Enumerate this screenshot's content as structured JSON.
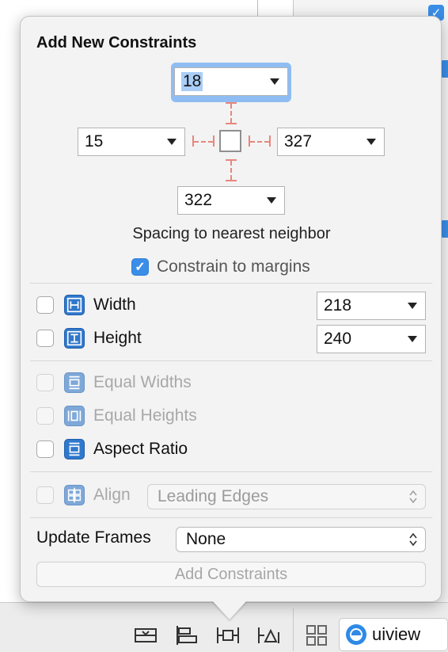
{
  "popover": {
    "title": "Add New Constraints",
    "spacing": {
      "top": "18",
      "left": "15",
      "right": "327",
      "bottom": "322",
      "caption": "Spacing to nearest neighbor"
    },
    "constrain_to_margins": {
      "label": "Constrain to margins",
      "checked": true
    },
    "size_rows": [
      {
        "label": "Width",
        "value": "218",
        "checked": false,
        "enabled": true
      },
      {
        "label": "Height",
        "value": "240",
        "checked": false,
        "enabled": true
      }
    ],
    "relation_rows": [
      {
        "label": "Equal Widths",
        "checked": false,
        "enabled": false
      },
      {
        "label": "Equal Heights",
        "checked": false,
        "enabled": false
      },
      {
        "label": "Aspect Ratio",
        "checked": false,
        "enabled": true
      }
    ],
    "align": {
      "label": "Align",
      "value": "Leading Edges",
      "enabled": false
    },
    "update_frames": {
      "label": "Update Frames",
      "value": "None"
    },
    "add_button": "Add Constraints"
  },
  "bottom_bar": {
    "object_selector": "uiview"
  },
  "colors": {
    "accent": "#3b8ee8",
    "guide": "#e8867d",
    "icon_blue": "#2f78cc"
  }
}
